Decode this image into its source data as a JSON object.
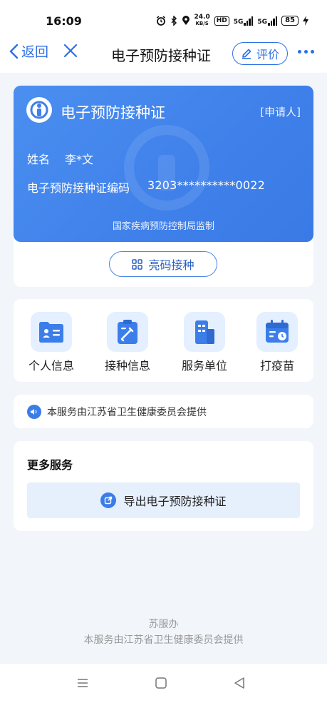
{
  "status_bar": {
    "time": "16:09",
    "net_speed_value": "24.0",
    "net_speed_unit": "KB/S",
    "hd_label": "HD",
    "sim1_label": "5G",
    "sim2_label": "5G",
    "battery": "85"
  },
  "nav": {
    "back_label": "返回",
    "title": "电子预防接种证",
    "rate_label": "评价"
  },
  "certificate": {
    "title": "电子预防接种证",
    "role": "[申请人]",
    "name_label": "姓名",
    "name_value": "李*文",
    "code_label": "电子预防接种证编码",
    "code_value": "3203**********0022",
    "supervision": "国家疾病预防控制局监制",
    "qr_button_label": "亮码接种"
  },
  "services": [
    {
      "label": "个人信息",
      "icon": "id-card-icon"
    },
    {
      "label": "接种信息",
      "icon": "clipboard-syringe-icon"
    },
    {
      "label": "服务单位",
      "icon": "building-icon"
    },
    {
      "label": "打疫苗",
      "icon": "calendar-clock-icon"
    }
  ],
  "notice": {
    "text": "本服务由江苏省卫生健康委员会提供"
  },
  "more_services": {
    "title": "更多服务",
    "export_label": "导出电子预防接种证"
  },
  "footer": {
    "line1": "苏服办",
    "line2": "本服务由江苏省卫生健康委员会提供"
  },
  "colors": {
    "accent": "#2d6fe4",
    "card_blue": "#4286ec",
    "page_bg": "#f2f5fa"
  }
}
